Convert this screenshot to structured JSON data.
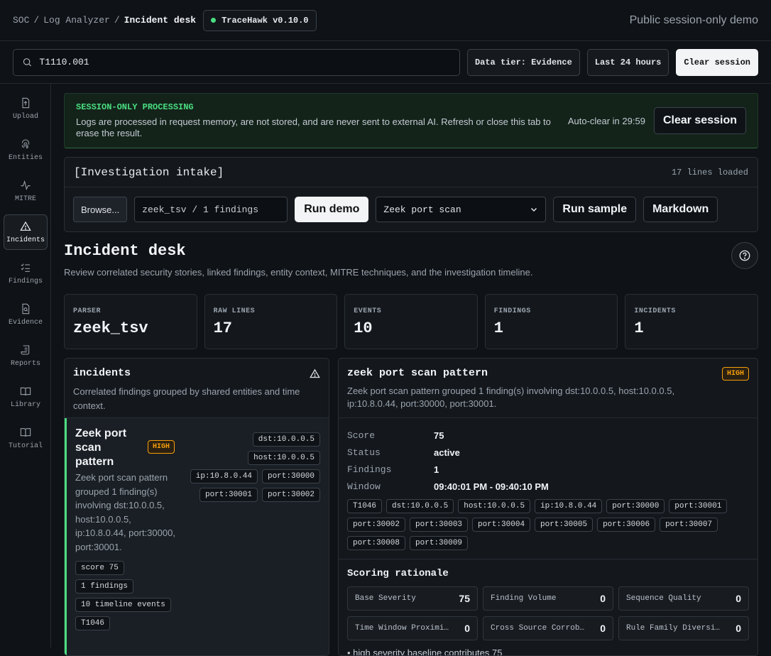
{
  "header": {
    "breadcrumb": [
      "SOC",
      "Log Analyzer",
      "Incident desk"
    ],
    "version": "TraceHawk v0.10.0",
    "right_text": "Public session-only demo"
  },
  "search": {
    "value": "T1110.001",
    "placeholder": ""
  },
  "toolbar": {
    "data_tier": "Data tier: Evidence",
    "time_range": "Last 24 hours",
    "clear_session": "Clear session"
  },
  "sidebar": {
    "items": [
      {
        "label": "Upload",
        "icon": "upload-icon"
      },
      {
        "label": "Entities",
        "icon": "fingerprint-icon"
      },
      {
        "label": "MITRE",
        "icon": "activity-icon"
      },
      {
        "label": "Incidents",
        "icon": "warning-icon",
        "active": true
      },
      {
        "label": "Findings",
        "icon": "checklist-icon"
      },
      {
        "label": "Evidence",
        "icon": "file-search-icon"
      },
      {
        "label": "Reports",
        "icon": "scroll-icon"
      },
      {
        "label": "Library",
        "icon": "book-icon"
      },
      {
        "label": "Tutorial",
        "icon": "book-open-icon"
      }
    ]
  },
  "banner": {
    "title": "SESSION-ONLY PROCESSING",
    "body": "Logs are processed in request memory, are not stored, and are never sent to external AI. Refresh or close this tab to erase the result.",
    "auto_clear": "Auto-clear in 29:59",
    "button": "Clear session"
  },
  "intake": {
    "title": "[Investigation intake]",
    "lines_loaded": "17 lines loaded",
    "browse": "Browse...",
    "file_value": "zeek_tsv / 1 findings",
    "run_demo": "Run demo",
    "sample_selected": "Zeek port scan",
    "run_sample": "Run sample",
    "markdown": "Markdown"
  },
  "page": {
    "title": "Incident desk",
    "subtitle": "Review correlated security stories, linked findings, entity context, MITRE techniques, and the investigation timeline."
  },
  "stats": [
    {
      "label": "PARSER",
      "value": "zeek_tsv"
    },
    {
      "label": "RAW LINES",
      "value": "17"
    },
    {
      "label": "EVENTS",
      "value": "10"
    },
    {
      "label": "FINDINGS",
      "value": "1"
    },
    {
      "label": "INCIDENTS",
      "value": "1"
    }
  ],
  "incidents_panel": {
    "title": "incidents",
    "subtitle": "Correlated findings grouped by shared entities and time context.",
    "card": {
      "title": "Zeek port scan pattern",
      "severity": "HIGH",
      "description": "Zeek port scan pattern grouped 1 finding(s) involving dst:10.0.0.5, host:10.0.0.5, ip:10.8.0.44, port:30000, port:30001.",
      "tags": [
        "dst:10.0.0.5",
        "host:10.0.0.5",
        "ip:10.8.0.44",
        "port:30000",
        "port:30001",
        "port:30002"
      ],
      "meta": [
        "score 75",
        "1 findings",
        "10 timeline events",
        "T1046"
      ]
    }
  },
  "detail": {
    "title": "zeek port scan pattern",
    "severity": "HIGH",
    "subtitle": "Zeek port scan pattern grouped 1 finding(s) involving dst:10.0.0.5, host:10.0.0.5, ip:10.8.0.44, port:30000, port:30001.",
    "fields": [
      {
        "k": "Score",
        "v": "75"
      },
      {
        "k": "Status",
        "v": "active"
      },
      {
        "k": "Findings",
        "v": "1"
      },
      {
        "k": "Window",
        "v": "09:40:01 PM - 09:40:10 PM"
      }
    ],
    "tags": [
      "T1046",
      "dst:10.0.0.5",
      "host:10.0.0.5",
      "ip:10.8.0.44",
      "port:30000",
      "port:30001",
      "port:30002",
      "port:30003",
      "port:30004",
      "port:30005",
      "port:30006",
      "port:30007",
      "port:30008",
      "port:30009"
    ],
    "scoring_title": "Scoring rationale",
    "scoring": [
      {
        "label": "Base Severity",
        "value": "75"
      },
      {
        "label": "Finding Volume",
        "value": "0"
      },
      {
        "label": "Sequence Quality",
        "value": "0"
      },
      {
        "label": "Time Window Proximity",
        "value": "0"
      },
      {
        "label": "Cross Source Corroboration",
        "value": "0"
      },
      {
        "label": "Rule Family Diversity",
        "value": "0"
      }
    ],
    "rationale_first": "high severity baseline contributes 75"
  },
  "colors": {
    "accent_green": "#4ade80",
    "severity_high": "#f59e0b",
    "background": "#0f1216"
  }
}
